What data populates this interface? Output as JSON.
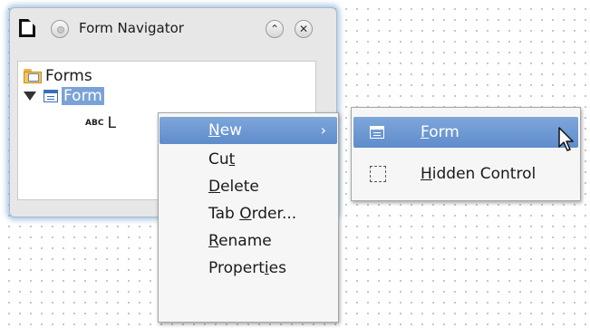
{
  "window": {
    "title": "Form Navigator",
    "title_icon": "form-navigator-app-icon",
    "buttons": {
      "shade": "⌃",
      "close": "✕"
    }
  },
  "tree": {
    "root": {
      "label": "Forms",
      "icon": "forms-folder-icon"
    },
    "form": {
      "label": "Form",
      "icon": "form-icon",
      "expanded": true,
      "selected": true
    },
    "child": {
      "label": "L",
      "icon_text": "ABC"
    }
  },
  "context_menu": {
    "items": [
      {
        "mnemonic": "N",
        "rest": "ew",
        "prefix": "",
        "has_submenu": true,
        "active": true
      },
      {
        "prefix": "Cu",
        "mnemonic": "t",
        "rest": ""
      },
      {
        "prefix": "",
        "mnemonic": "D",
        "rest": "elete"
      },
      {
        "prefix": "Tab ",
        "mnemonic": "O",
        "rest": "rder..."
      },
      {
        "prefix": "",
        "mnemonic": "R",
        "rest": "ename"
      },
      {
        "prefix": "Propert",
        "mnemonic": "i",
        "rest": "es"
      }
    ],
    "submenu_arrow": "›"
  },
  "submenu": {
    "items": [
      {
        "prefix": "",
        "mnemonic": "F",
        "rest": "orm",
        "icon": "form-icon",
        "active": true
      },
      {
        "prefix": "",
        "mnemonic": "H",
        "rest": "idden Control",
        "icon": "hidden-control-icon"
      }
    ]
  },
  "colors": {
    "highlight": "#6b95d0",
    "window_glow": "#6ea0d2",
    "menu_bg": "#f6f6f6"
  }
}
